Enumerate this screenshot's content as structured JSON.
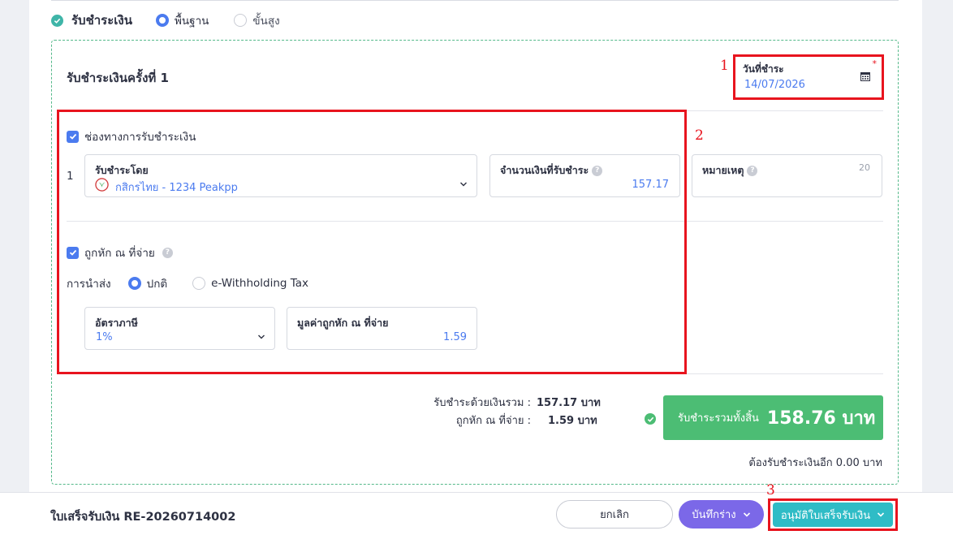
{
  "payment_mode": {
    "label": "รับชำระเงิน",
    "options": [
      "พื้นฐาน",
      "ขั้นสูง"
    ],
    "selected": "พื้นฐาน"
  },
  "installment": {
    "title": "รับชำระเงินครั้งที่ 1",
    "date_label": "วันที่ชำระ",
    "required_mark": "*",
    "date_value": "14/07/2026"
  },
  "channel": {
    "checkbox_label": "ช่องทางการรับชำระเงิน",
    "row_index": "1",
    "paid_by_label": "รับชำระโดย",
    "paid_by_value": "กสิกรไทย - 1234 Peakpp",
    "amount_label": "จำนวนเงินที่รับชำระ",
    "amount_value": "157.17",
    "note_label": "หมายเหตุ",
    "note_counter": "20"
  },
  "withholding": {
    "checkbox_label": "ถูกหัก ณ ที่จ่าย",
    "submit_label": "การนำส่ง",
    "options": [
      "ปกติ",
      "e-Withholding Tax"
    ],
    "selected": "ปกติ",
    "rate_label": "อัตราภาษี",
    "rate_value": "1%",
    "value_label": "มูลค่าถูกหัก ณ ที่จ่าย",
    "value_value": "1.59"
  },
  "totals": {
    "cash_label": "รับชำระด้วยเงินรวม :",
    "cash_value": "157.17 บาท",
    "wht_label": "ถูกหัก ณ ที่จ่าย :",
    "wht_value": "1.59 บาท",
    "grand_label": "รับชำระรวมทั้งสิ้น",
    "grand_value": "158.76 บาท",
    "remaining": "ต้องรับชำระเงินอีก 0.00 บาท"
  },
  "annotations": [
    "1",
    "2",
    "3"
  ],
  "footer": {
    "doc_title": "ใบเสร็จรับเงิน RE-20260714002",
    "cancel": "ยกเลิก",
    "draft": "บันทึกร่าง",
    "approve": "อนุมัติใบเสร็จรับเงิน"
  },
  "colors": {
    "primary": "#4b7bef",
    "success": "#4cbd74",
    "teal": "#2fbcc6",
    "purple": "#7b68e8",
    "annotation_red": "#e8141e"
  }
}
